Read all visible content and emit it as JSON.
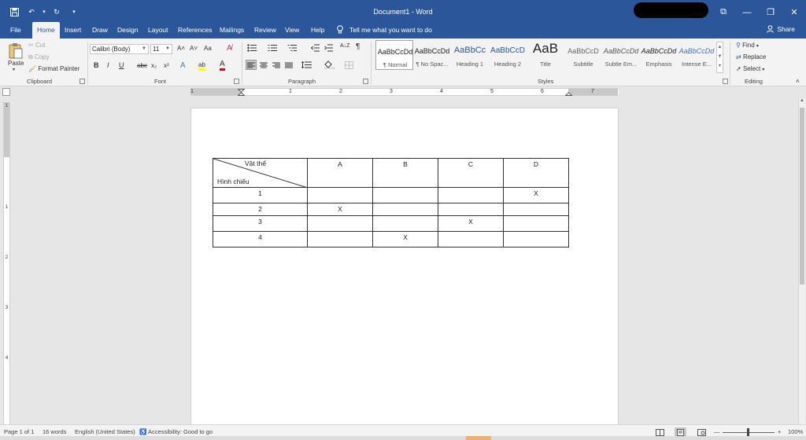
{
  "window": {
    "title": "Document1  -  Word",
    "controls": {
      "ribbon_display": "⧉",
      "minimize": "—",
      "restore": "❐",
      "close": "✕"
    }
  },
  "quick_access": {
    "save": "💾",
    "undo": "↶",
    "undo_dropdown": "▾",
    "redo": "↻",
    "customize": "▾"
  },
  "tabs": [
    "File",
    "Home",
    "Insert",
    "Draw",
    "Design",
    "Layout",
    "References",
    "Mailings",
    "Review",
    "View",
    "Help"
  ],
  "active_tab": "Home",
  "tell_me": "Tell me what you want to do",
  "share_label": "Share",
  "clipboard": {
    "paste": "Paste",
    "cut": "Cut",
    "copy": "Copy",
    "format_painter": "Format Painter",
    "group_label": "Clipboard"
  },
  "font": {
    "family": "Calibri (Body)",
    "size": "11",
    "group_label": "Font",
    "grow": "A˄",
    "shrink": "A˅",
    "change_case": "Aa",
    "clear": "A̸",
    "bold": "B",
    "italic": "I",
    "underline": "U",
    "strike": "abc",
    "subscript": "x₂",
    "superscript": "x²",
    "effects": "A",
    "highlight": "ab",
    "color": "A"
  },
  "paragraph": {
    "group_label": "Paragraph",
    "pilcrow": "¶",
    "sort": "A↓Z"
  },
  "styles": {
    "group_label": "Styles",
    "items": [
      {
        "preview": "AaBbCcDd",
        "name": "¶ Normal"
      },
      {
        "preview": "AaBbCcDd",
        "name": "¶ No Spac..."
      },
      {
        "preview": "AaBbCc",
        "name": "Heading 1"
      },
      {
        "preview": "AaBbCcD",
        "name": "Heading 2"
      },
      {
        "preview": "AaB",
        "name": "Title"
      },
      {
        "preview": "AaBbCcD",
        "name": "Subtitle"
      },
      {
        "preview": "AaBbCcDd",
        "name": "Subtle Em..."
      },
      {
        "preview": "AaBbCcDd",
        "name": "Emphasis"
      },
      {
        "preview": "AaBbCcDd",
        "name": "Intense E..."
      }
    ]
  },
  "editing": {
    "find": "Find",
    "replace": "Replace",
    "select": "Select",
    "group_label": "Editing"
  },
  "ruler": {
    "h_numbers": [
      "1",
      "1",
      "2",
      "3",
      "4",
      "5",
      "6",
      "7"
    ],
    "v_numbers": [
      "1",
      "1",
      "2",
      "3",
      "4"
    ]
  },
  "table": {
    "diag_top": "Vật thể",
    "diag_bottom": "Hình chiếu",
    "columns": [
      "A",
      "B",
      "C",
      "D"
    ],
    "rows": [
      {
        "label": "1",
        "cells": [
          "",
          "",
          "",
          "X"
        ]
      },
      {
        "label": "2",
        "cells": [
          "X",
          "",
          "",
          ""
        ]
      },
      {
        "label": "3",
        "cells": [
          "",
          "",
          "X",
          ""
        ]
      },
      {
        "label": "4",
        "cells": [
          "",
          "X",
          "",
          ""
        ]
      }
    ]
  },
  "status": {
    "page": "Page 1 of 1",
    "words": "16 words",
    "language": "English (United States)",
    "accessibility": "Accessibility: Good to go",
    "zoom": "100%"
  }
}
